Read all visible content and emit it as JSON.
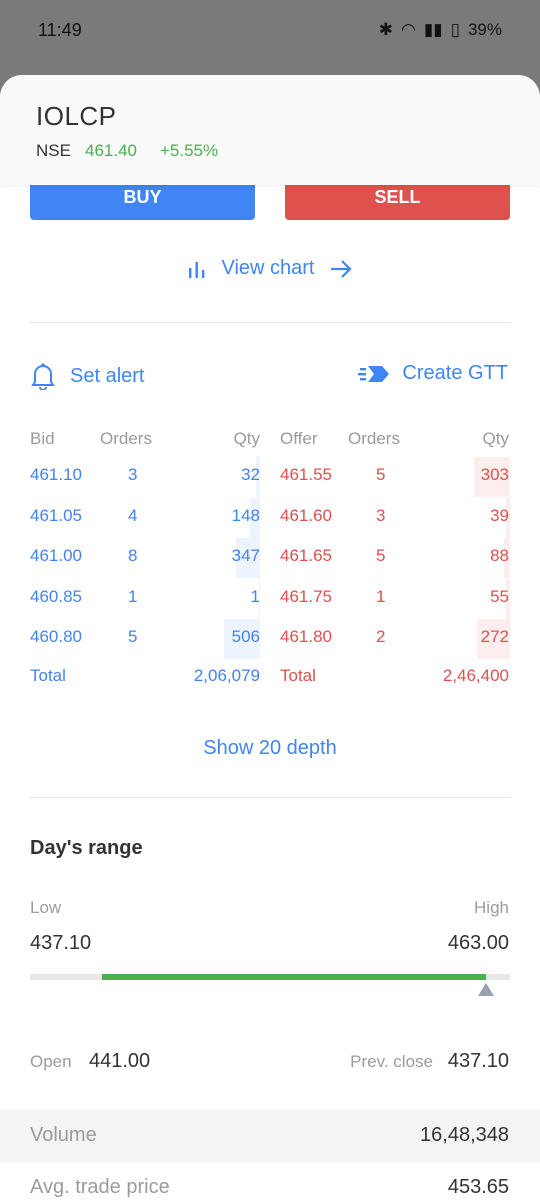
{
  "status": {
    "time": "11:49",
    "battery": "39%",
    "indicators": [
      "bluetooth-icon",
      "wifi-icon",
      "wifi-call-icon",
      "volte-icon",
      "signal-icon",
      "signal-icon",
      "battery-icon"
    ]
  },
  "header": {
    "symbol": "IOLCP",
    "exchange": "NSE",
    "ltp": "461.40",
    "change": "+5.55%",
    "change_color": "#4caf50"
  },
  "actions": {
    "buy": "BUY",
    "sell": "SELL",
    "buy_color": "#4184f3",
    "sell_color": "#df514c"
  },
  "view_chart": "View chart",
  "set_alert": "Set alert",
  "create_gtt": "Create GTT",
  "depth": {
    "headers": {
      "bid": "Bid",
      "bid_orders": "Orders",
      "bid_qty": "Qty",
      "offer": "Offer",
      "offer_orders": "Orders",
      "offer_qty": "Qty"
    },
    "rows": [
      {
        "bid": "461.10",
        "bid_orders": "3",
        "bid_qty": "32",
        "offer": "461.55",
        "offer_orders": "5",
        "offer_qty": "303"
      },
      {
        "bid": "461.05",
        "bid_orders": "4",
        "bid_qty": "148",
        "offer": "461.60",
        "offer_orders": "3",
        "offer_qty": "39"
      },
      {
        "bid": "461.00",
        "bid_orders": "8",
        "bid_qty": "347",
        "offer": "461.65",
        "offer_orders": "5",
        "offer_qty": "88"
      },
      {
        "bid": "460.85",
        "bid_orders": "1",
        "bid_qty": "1",
        "offer": "461.75",
        "offer_orders": "1",
        "offer_qty": "55"
      },
      {
        "bid": "460.80",
        "bid_orders": "5",
        "bid_qty": "506",
        "offer": "461.80",
        "offer_orders": "2",
        "offer_qty": "272"
      }
    ],
    "total_label": "Total",
    "bid_total": "2,06,079",
    "offer_total": "2,46,400"
  },
  "show_depth": "Show 20 depth",
  "range": {
    "title": "Day's range",
    "low_label": "Low",
    "high_label": "High",
    "low": "437.10",
    "high": "463.00",
    "open_fraction": 0.15,
    "ltp_fraction": 0.95
  },
  "stats": {
    "open_label": "Open",
    "open": "441.00",
    "prev_label": "Prev. close",
    "prev": "437.10",
    "volume_label": "Volume",
    "volume": "16,48,348",
    "atp_label": "Avg. trade price",
    "atp": "453.65"
  }
}
